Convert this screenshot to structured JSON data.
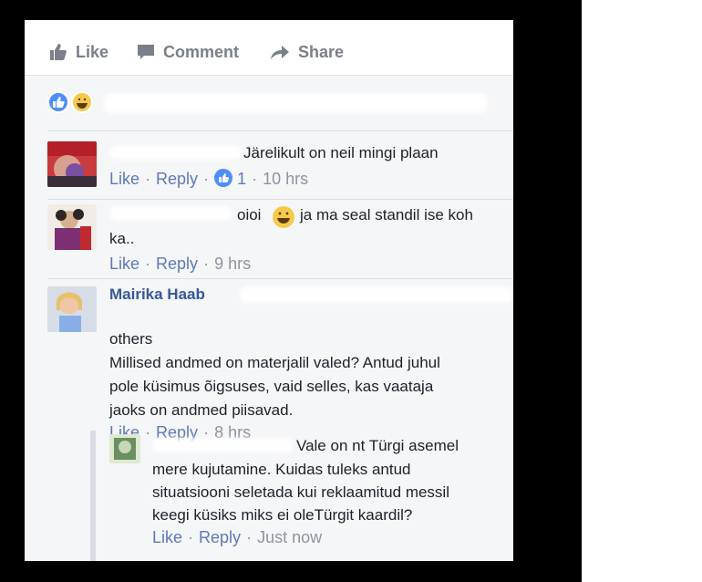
{
  "actions": {
    "like": "Like",
    "comment": "Comment",
    "share": "Share"
  },
  "comments": [
    {
      "name": "",
      "text": "Järelikult on neil mingi plaan",
      "like": "Like",
      "reply": "Reply",
      "reaction_count": "1",
      "time": "10 hrs"
    },
    {
      "name": "",
      "text_1": "oioi",
      "text_2": "ja ma seal standil ise koh",
      "text_3": "ka..",
      "like": "Like",
      "reply": "Reply",
      "time": "9 hrs"
    },
    {
      "name": "Mairika Haab",
      "intro": "others",
      "text_1": "Millised andmed on materjalil valed? Antud juhul",
      "text_2": "pole küsimus õigsuses, vaid selles, kas vaataja",
      "text_3": "jaoks on andmed piisavad.",
      "like": "Like",
      "reply": "Reply",
      "time": "8 hrs"
    }
  ],
  "reply": {
    "name": "",
    "text_1": "Vale on nt Türgi asemel",
    "text_2": "mere kujutamine. Kuidas tuleks antud",
    "text_3": "situatsiooni seletada kui reklaamitud messil",
    "text_4": "keegi küsiks miks ei oleTürgit kaardil?",
    "like": "Like",
    "reply": "Reply",
    "time": "Just now"
  },
  "colors": {
    "link": "#365899",
    "meta": "#8d949e",
    "action": "#7a7f89",
    "reaction_blue": "#4d8ff6",
    "reaction_yellow": "#f7c94a"
  }
}
